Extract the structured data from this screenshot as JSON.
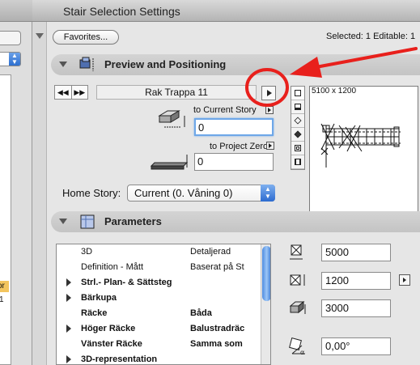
{
  "window": {
    "title": "Stair Selection Settings"
  },
  "left_panel": {
    "highlight_text": "or",
    "number_text": "1"
  },
  "favorites": {
    "label": "Favorites..."
  },
  "selection": {
    "info": "Selected: 1 Editable: 1"
  },
  "preview_section": {
    "title": "Preview and Positioning",
    "stair_name": "Rak Trappa 11",
    "dimensions": "5100 x 1200",
    "to_current_story_label": "to Current Story",
    "to_current_story_value": "0",
    "to_project_zero_label": "to Project Zero",
    "to_project_zero_value": "0",
    "home_story_label": "Home Story:",
    "home_story_value": "Current (0. Våning 0)"
  },
  "parameters_section": {
    "title": "Parameters",
    "rows": [
      {
        "name": "3D",
        "value": "Detaljerad",
        "expandable": false,
        "bold": false,
        "value_bold": false
      },
      {
        "name": "Definition - Mått",
        "value": "Baserat på St",
        "expandable": false,
        "bold": false,
        "value_bold": false
      },
      {
        "name": "Strl.- Plan- & Sättsteg",
        "value": "",
        "expandable": true,
        "bold": true,
        "value_bold": false
      },
      {
        "name": "Bärkupa",
        "value": "",
        "expandable": true,
        "bold": true,
        "value_bold": false
      },
      {
        "name": "Räcke",
        "value": "Båda",
        "expandable": false,
        "bold": true,
        "value_bold": true
      },
      {
        "name": "Höger Räcke",
        "value": "Balustradräc",
        "expandable": true,
        "bold": true,
        "value_bold": true
      },
      {
        "name": "Vänster Räcke",
        "value": "Samma som",
        "expandable": false,
        "bold": true,
        "value_bold": true
      },
      {
        "name": "3D-representation",
        "value": "",
        "expandable": true,
        "bold": true,
        "value_bold": false
      }
    ],
    "length_value": "5000",
    "width_value": "1200",
    "height_value": "3000",
    "angle_value": "0,00°"
  }
}
